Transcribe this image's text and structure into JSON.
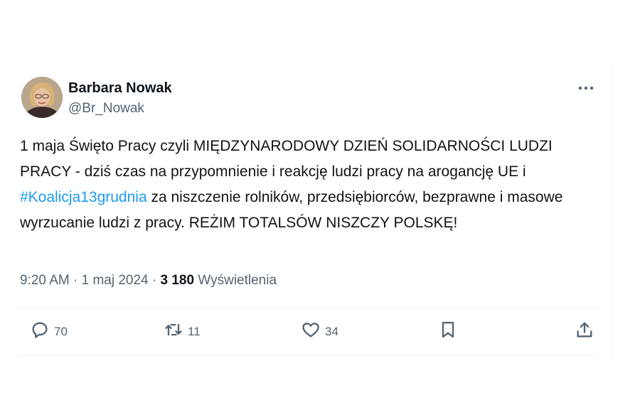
{
  "post": {
    "author_name": "Barbara Nowak",
    "author_handle": "@Br_Nowak",
    "text_part1": "1 maja Święto Pracy czyli MIĘDZYNARODOWY DZIEŃ SOLIDARNOŚCI LUDZI PRACY - dziś czas na przypomnienie i reakcję ludzi pracy na arogancję UE i ",
    "hashtag": "#Koalicja13grudnia",
    "text_part2": " za niszczenie rolników, przedsiębiorców, bezprawne i masowe wyrzucanie ludzi z pracy. REŻIM TOTALSÓW NISZCZY POLSKĘ!",
    "time": "9:20 AM",
    "date": "1 maj 2024",
    "separator": "·",
    "views_count": "3 180",
    "views_label": "Wyświetlenia"
  },
  "actions": {
    "replies": "70",
    "reposts": "11",
    "likes": "34"
  },
  "icons": {
    "more": "more-icon",
    "reply": "reply-icon",
    "repost": "repost-icon",
    "like": "heart-icon",
    "bookmark": "bookmark-icon",
    "share": "share-icon"
  },
  "colors": {
    "hashtag": "#1d9bf0",
    "muted": "#536471",
    "text": "#0f1419"
  }
}
